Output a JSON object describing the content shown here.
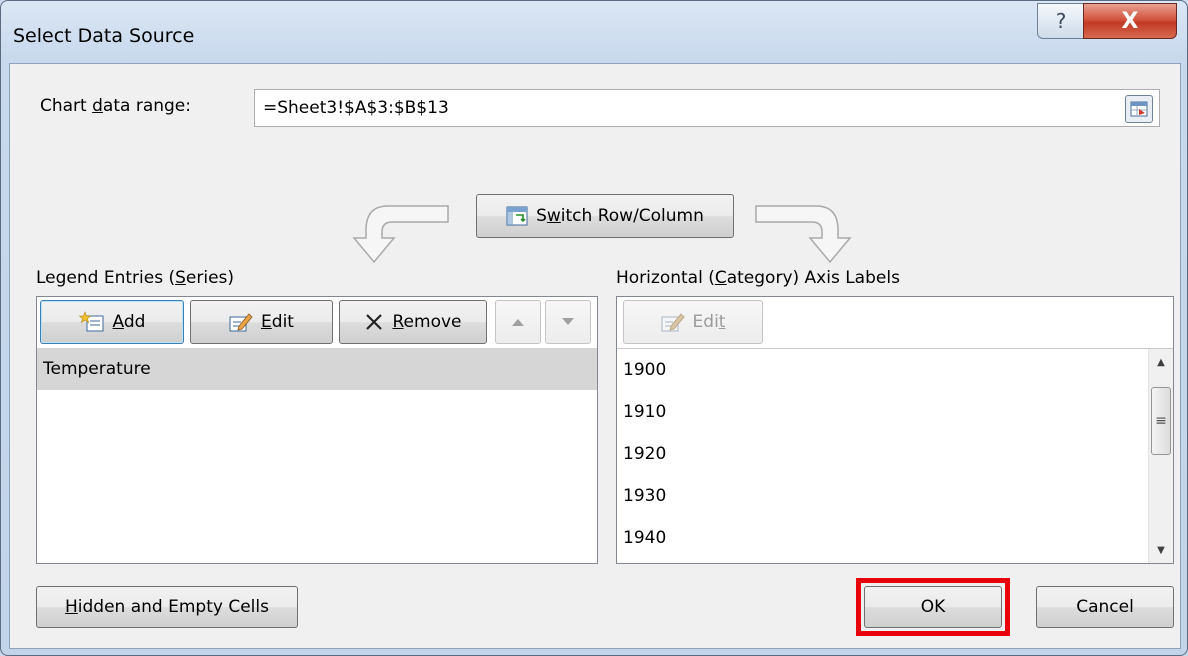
{
  "window": {
    "title": "Select Data Source",
    "help_label": "?",
    "close_label": "X"
  },
  "range": {
    "label_prefix": "Chart ",
    "label_accel": "d",
    "label_suffix": "ata range:",
    "value": "=Sheet3!$A$3:$B$13"
  },
  "switch_button": {
    "prefix": "S",
    "accel": "w",
    "suffix": "itch Row/Column"
  },
  "legend": {
    "label_prefix": "Legend Entries (",
    "label_accel": "S",
    "label_suffix": "eries)",
    "add_accel": "A",
    "add_suffix": "dd",
    "edit_accel": "E",
    "edit_suffix": "dit",
    "remove_accel": "R",
    "remove_suffix": "emove",
    "items": [
      "Temperature"
    ]
  },
  "axis": {
    "label_prefix": "Horizontal (",
    "label_accel": "C",
    "label_suffix": "ategory) Axis Labels",
    "edit_prefix": "Edi",
    "edit_accel": "t",
    "items": [
      "1900",
      "1910",
      "1920",
      "1930",
      "1940"
    ]
  },
  "footer": {
    "hidden_accel": "H",
    "hidden_suffix": "idden and Empty Cells",
    "ok_label": "OK",
    "cancel_label": "Cancel"
  },
  "colors": {
    "highlight": "#e8000b",
    "close_button": "#c13a25"
  }
}
